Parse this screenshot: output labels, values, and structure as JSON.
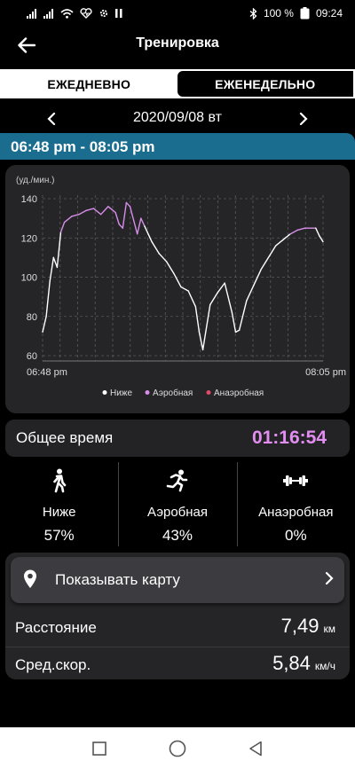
{
  "status_bar": {
    "battery": "100 %",
    "time": "09:24"
  },
  "header": {
    "title": "Тренировка"
  },
  "tabs": [
    {
      "label": "ЕЖЕДНЕВНО",
      "active": true
    },
    {
      "label": "ЕЖЕНЕДЕЛЬНО",
      "active": false
    }
  ],
  "date_nav": {
    "date": "2020/09/08 вт"
  },
  "session": {
    "time_range": "06:48 pm - 08:05 pm"
  },
  "chart_data": {
    "type": "line",
    "ylabel": "(уд./мин.)",
    "xlabel": "",
    "yticks": [
      "140",
      "120",
      "100",
      "80",
      "60"
    ],
    "ylim": [
      60,
      140
    ],
    "x_start_label": "06:48 pm",
    "x_end_label": "08:05 pm",
    "grid": true,
    "legend_position": "bottom",
    "series": [
      {
        "name": "Ниже",
        "color": "#ffffff"
      },
      {
        "name": "Аэробная",
        "color": "#d68ee8"
      },
      {
        "name": "Анаэробная",
        "color": "#e34a6a"
      }
    ],
    "x_minutes": [
      0,
      1,
      2,
      3,
      4,
      5,
      6,
      8,
      10,
      12,
      14,
      16,
      18,
      20,
      21,
      22,
      23,
      24,
      26,
      27,
      28,
      30,
      32,
      34,
      36,
      38,
      40,
      42,
      43,
      44,
      46,
      48,
      50,
      52,
      53,
      54,
      56,
      58,
      60,
      62,
      64,
      66,
      68,
      70,
      72,
      74,
      75,
      76,
      77
    ],
    "values": [
      72,
      80,
      98,
      110,
      105,
      123,
      128,
      131,
      132,
      134,
      135,
      132,
      136,
      133,
      127,
      125,
      138,
      136,
      122,
      130,
      126,
      118,
      112,
      108,
      102,
      95,
      93,
      85,
      72,
      63,
      86,
      92,
      97,
      82,
      72,
      73,
      88,
      96,
      104,
      110,
      116,
      119,
      122,
      124,
      125,
      125,
      125,
      121,
      118
    ]
  },
  "total_time": {
    "label": "Общее время",
    "value": "01:16:54"
  },
  "zones": [
    {
      "label": "Ниже",
      "value": "57%",
      "icon": "walk-icon"
    },
    {
      "label": "Аэробная",
      "value": "43%",
      "icon": "run-icon"
    },
    {
      "label": "Анаэробная",
      "value": "0%",
      "icon": "dumbbell-icon"
    }
  ],
  "map_button": {
    "label": "Показывать карту",
    "icon": "location-pin-icon"
  },
  "stats": [
    {
      "label": "Расстояние",
      "value": "7,49",
      "unit": "км"
    },
    {
      "label": "Сред.скор.",
      "value": "5,84",
      "unit": "км/ч"
    }
  ],
  "colors": {
    "accent": "#e28ef0",
    "session_band": "#1a6d8e",
    "card": "#252528"
  }
}
